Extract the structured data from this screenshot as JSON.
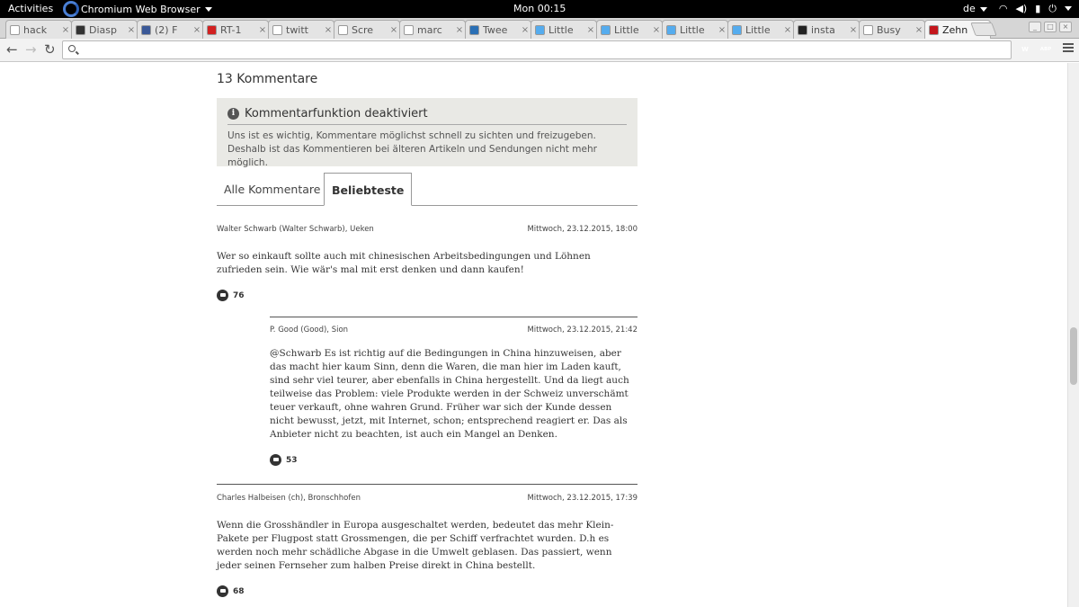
{
  "topbar": {
    "activities": "Activities",
    "app_name": "Chromium Web Browser",
    "clock": "Mon 00:15",
    "lang": "de"
  },
  "browser": {
    "tabs": [
      {
        "title": "hack",
        "favicon_color": "#ffffff"
      },
      {
        "title": "Diasp",
        "favicon_color": "#333333"
      },
      {
        "title": "(2) F",
        "favicon_color": "#3b5998"
      },
      {
        "title": "RT-1",
        "favicon_color": "#d22020"
      },
      {
        "title": "twitt",
        "favicon_color": "#ffffff"
      },
      {
        "title": "Scre",
        "favicon_color": "#ffffff"
      },
      {
        "title": "marc",
        "favicon_color": "#ffffff"
      },
      {
        "title": "Twee",
        "favicon_color": "#2a6fb5"
      },
      {
        "title": "Little",
        "favicon_color": "#55acee"
      },
      {
        "title": "Little",
        "favicon_color": "#55acee"
      },
      {
        "title": "Little",
        "favicon_color": "#55acee"
      },
      {
        "title": "Little",
        "favicon_color": "#55acee"
      },
      {
        "title": "insta",
        "favicon_color": "#222222"
      },
      {
        "title": "Busy",
        "favicon_color": "#ffffff"
      },
      {
        "title": "Zehn",
        "favicon_color": "#c4161c",
        "active": true
      }
    ],
    "address": "",
    "extensions": [
      {
        "label": "W",
        "color": "#c0282d"
      },
      {
        "label": "ABP",
        "color": "#d9242b"
      }
    ]
  },
  "comments_section": {
    "heading": "13 Kommentare",
    "notice": {
      "title": "Kommentarfunktion deaktiviert",
      "text": "Uns ist es wichtig, Kommentare möglichst schnell zu sichten und freizugeben. Deshalb ist das Kommentieren bei älteren Artikeln und Sendungen nicht mehr möglich."
    },
    "tabs": [
      "Alle Kommentare",
      "Beliebteste"
    ],
    "active_tab": "Beliebteste",
    "comments": [
      {
        "author": "Walter Schwarb (Walter Schwarb), Ueken",
        "date": "Mittwoch, 23.12.2015, 18:00",
        "text": "Wer so einkauft sollte auch mit chinesischen Arbeitsbedingungen und Löhnen zufrieden sein. Wie wär's mal mit erst denken und dann kaufen!",
        "likes": "76"
      },
      {
        "author": "P. Good (Good), Sion",
        "date": "Mittwoch, 23.12.2015, 21:42",
        "text": "@Schwarb Es ist richtig auf die Bedingungen in China hinzuweisen, aber das macht hier kaum Sinn, denn die Waren, die man hier im Laden kauft, sind sehr viel teurer, aber ebenfalls in China hergestellt. Und da liegt auch teilweise das Problem: viele Produkte werden in der Schweiz unverschämt teuer verkauft, ohne wahren Grund. Früher war sich der Kunde dessen nicht bewusst, jetzt, mit Internet, schon; entsprechend reagiert er. Das als Anbieter nicht zu beachten, ist auch ein Mangel an Denken.",
        "likes": "53"
      },
      {
        "author": "Charles Halbeisen (ch), Bronschhofen",
        "date": "Mittwoch, 23.12.2015, 17:39",
        "text": "Wenn die Grosshändler in Europa ausgeschaltet werden, bedeutet das mehr Klein-Pakete per Flugpost statt Grossmengen, die per Schiff verfrachtet wurden. D.h es werden noch mehr schädliche Abgase in die Umwelt geblasen. Das passiert, wenn jeder seinen Fernseher zum halben Preise direkt in China bestellt.",
        "likes": "68"
      }
    ]
  }
}
